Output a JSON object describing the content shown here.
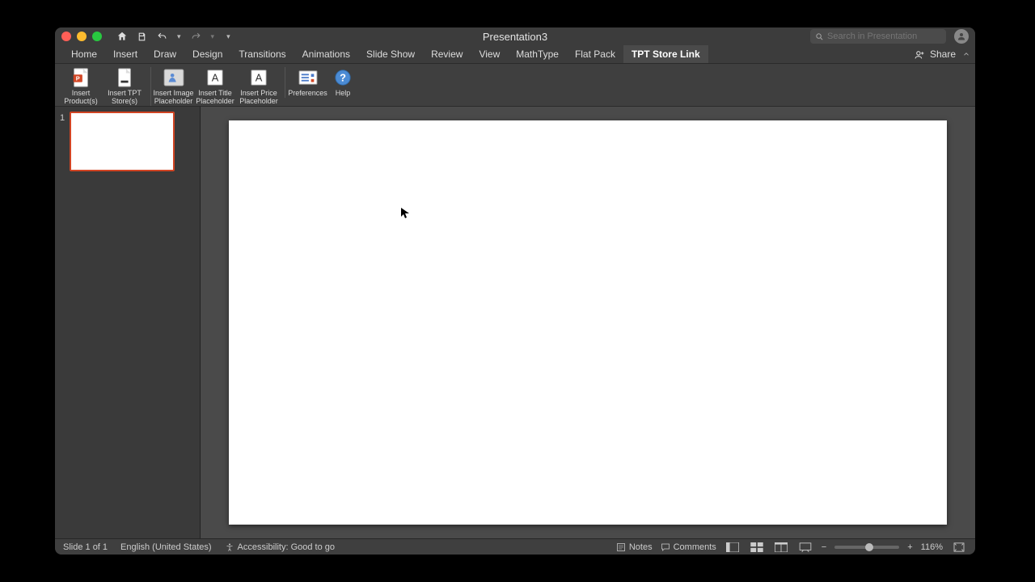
{
  "title": "Presentation3",
  "search": {
    "placeholder": "Search in Presentation"
  },
  "tabs": [
    {
      "label": "Home"
    },
    {
      "label": "Insert"
    },
    {
      "label": "Draw"
    },
    {
      "label": "Design"
    },
    {
      "label": "Transitions"
    },
    {
      "label": "Animations"
    },
    {
      "label": "Slide Show"
    },
    {
      "label": "Review"
    },
    {
      "label": "View"
    },
    {
      "label": "MathType"
    },
    {
      "label": "Flat Pack"
    },
    {
      "label": "TPT Store Link"
    }
  ],
  "active_tab_index": 11,
  "share_label": "Share",
  "ribbon": [
    {
      "label": "Insert\nProduct(s)"
    },
    {
      "label": "Insert TPT\nStore(s)"
    },
    {
      "label": "Insert Image\nPlaceholder"
    },
    {
      "label": "Insert Title\nPlaceholder"
    },
    {
      "label": "Insert Price\nPlaceholder"
    },
    {
      "label": "Preferences"
    },
    {
      "label": "Help"
    }
  ],
  "thumbnail": {
    "number": "1"
  },
  "status": {
    "slide_of": "Slide 1 of 1",
    "language": "English (United States)",
    "accessibility": "Accessibility: Good to go",
    "notes": "Notes",
    "comments": "Comments",
    "zoom": "116%"
  }
}
